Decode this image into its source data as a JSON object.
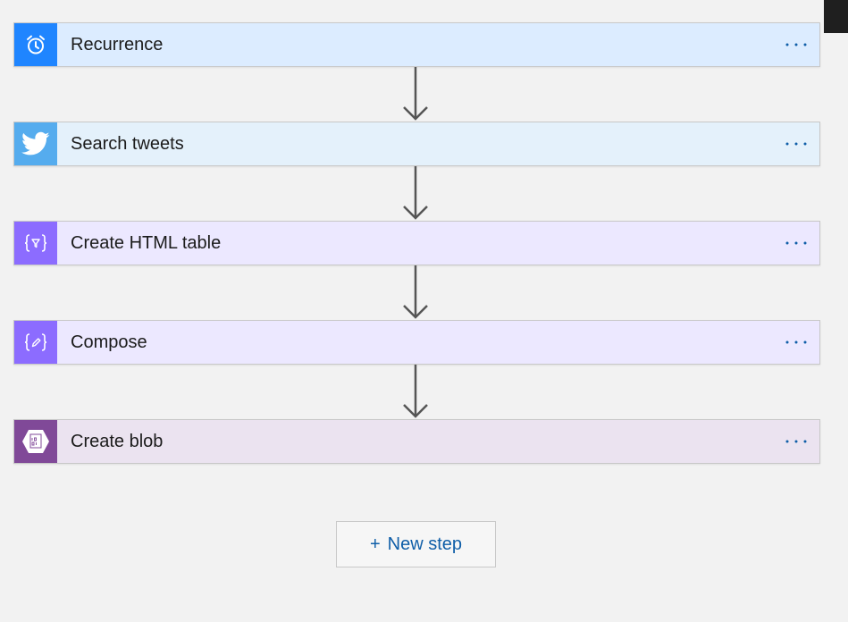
{
  "steps": [
    {
      "title": "Recurrence",
      "icon": "alarm-clock-icon",
      "icon_bg": "#1f85ff",
      "card_bg": "#dcecff"
    },
    {
      "title": "Search tweets",
      "icon": "twitter-bird-icon",
      "icon_bg": "#55acee",
      "card_bg": "#e4f1fb"
    },
    {
      "title": "Create HTML table",
      "icon": "data-operation-icon",
      "icon_bg": "#8c6cff",
      "card_bg": "#ece8ff"
    },
    {
      "title": "Compose",
      "icon": "compose-icon",
      "icon_bg": "#8c6cff",
      "card_bg": "#ece8ff"
    },
    {
      "title": "Create blob",
      "icon": "blob-storage-icon",
      "icon_bg": "#804998",
      "card_bg": "#ebe3f0"
    }
  ],
  "more_icon": "ellipsis-icon",
  "new_step": {
    "plus": "+",
    "label": "New step"
  },
  "colors": {
    "canvas_bg": "#f2f2f2",
    "card_border": "#c8c8c8",
    "accent": "#0f5ea8",
    "arrow": "#555555"
  }
}
